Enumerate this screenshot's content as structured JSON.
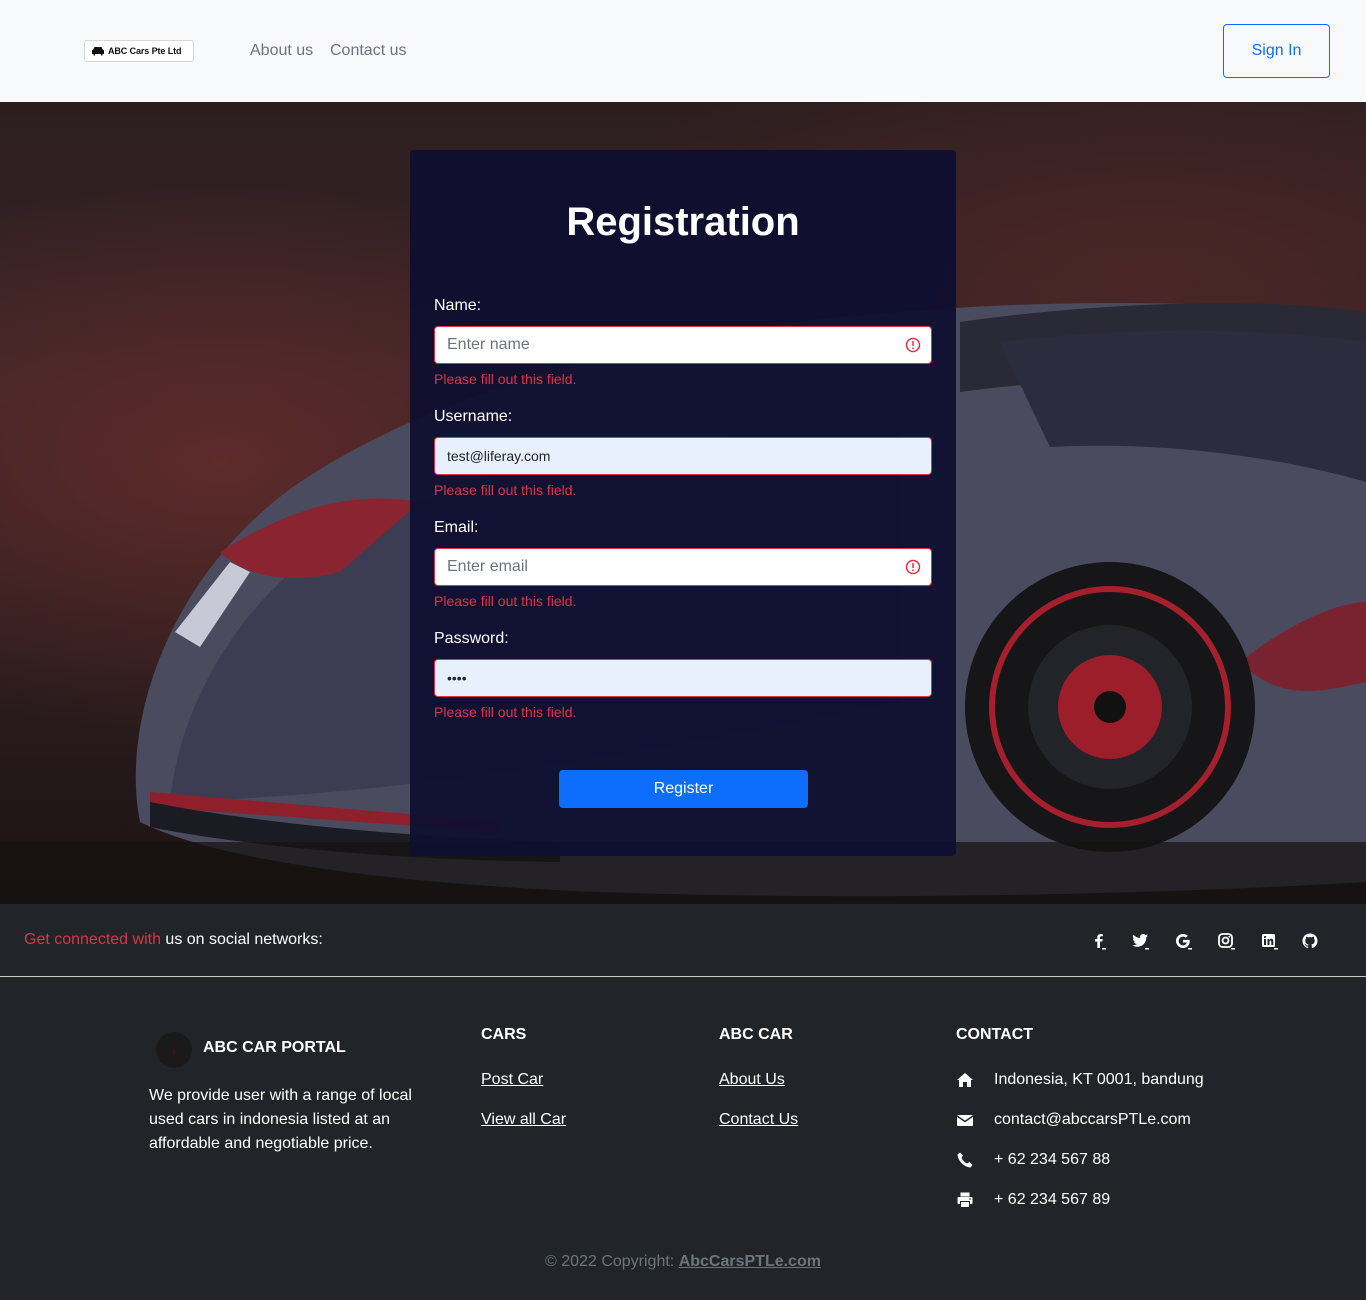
{
  "navbar": {
    "brand": "ABC Cars Pte Ltd",
    "links": [
      "About us",
      "Contact us"
    ],
    "signin_label": "Sign In"
  },
  "form": {
    "title": "Registration",
    "fields": [
      {
        "label": "Name:",
        "placeholder": "Enter name",
        "value": "",
        "error": "Please fill out this field."
      },
      {
        "label": "Username:",
        "placeholder": "",
        "value": "test@liferay.com",
        "error": "Please fill out this field."
      },
      {
        "label": "Email:",
        "placeholder": "Enter email",
        "value": "",
        "error": "Please fill out this field."
      },
      {
        "label": "Password:",
        "placeholder": "",
        "value": "••••",
        "error": "Please fill out this field."
      }
    ],
    "submit_label": "Register"
  },
  "social": {
    "text_highlight": "Get connected with",
    "text_rest": " us on social networks:",
    "icons": [
      "facebook-icon",
      "twitter-icon",
      "google-icon",
      "instagram-icon",
      "linkedin-icon",
      "github-icon"
    ]
  },
  "footer": {
    "brand_title": "ABC CAR PORTAL",
    "brand_desc": "We provide user with a range of local used cars in indonesia listed at an affordable and negotiable price.",
    "cars": {
      "heading": "CARS",
      "links": [
        "Post Car",
        "View all Car"
      ]
    },
    "abc": {
      "heading": "ABC CAR",
      "links": [
        "About Us",
        "Contact Us"
      ]
    },
    "contact": {
      "heading": "CONTACT",
      "address": "Indonesia, KT 0001, bandung",
      "email": "contact@abccarsPTLe.com",
      "phone": "+ 62 234 567 88",
      "fax": "+ 62 234 567 89"
    },
    "copyright_prefix": "© 2022 Copyright: ",
    "copyright_link": "AbcCarsPTLe.com"
  },
  "colors": {
    "primary": "#0d6efd",
    "danger": "#dc3545",
    "dark": "#212529",
    "card": "#0e0e30"
  }
}
